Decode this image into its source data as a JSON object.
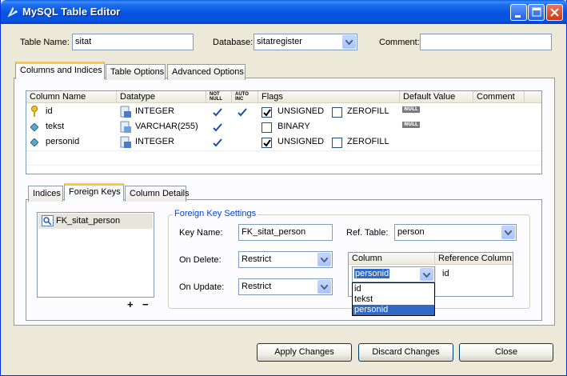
{
  "window": {
    "title": "MySQL Table Editor"
  },
  "top": {
    "table_name_label": "Table Name:",
    "table_name_value": "sitat",
    "database_label": "Database:",
    "database_value": "sitatregister",
    "comment_label": "Comment:",
    "comment_value": ""
  },
  "main_tabs": [
    {
      "label": "Columns and Indices",
      "active": true
    },
    {
      "label": "Table Options",
      "active": false
    },
    {
      "label": "Advanced Options",
      "active": false
    }
  ],
  "columns_grid": {
    "headers": {
      "column_name": "Column Name",
      "datatype": "Datatype",
      "not_null_1": "NOT",
      "not_null_2": "NULL",
      "auto_inc_1": "AUTO",
      "auto_inc_2": "INC",
      "flags": "Flags",
      "default_value": "Default Value",
      "comment": "Comment"
    },
    "rows": [
      {
        "name": "id",
        "datatype": "INTEGER",
        "not_null": true,
        "auto_inc": true,
        "flag1": "UNSIGNED",
        "flag1_checked": true,
        "flag2": "ZEROFILL",
        "flag2_checked": false,
        "default": "NULL",
        "primary_key": true
      },
      {
        "name": "tekst",
        "datatype": "VARCHAR(255)",
        "not_null": true,
        "auto_inc": false,
        "flag1": "BINARY",
        "flag1_checked": false,
        "flag2": "",
        "flag2_checked": false,
        "default": "NULL",
        "primary_key": false
      },
      {
        "name": "personid",
        "datatype": "INTEGER",
        "not_null": true,
        "auto_inc": false,
        "flag1": "UNSIGNED",
        "flag1_checked": true,
        "flag2": "ZEROFILL",
        "flag2_checked": false,
        "default": "",
        "primary_key": false
      }
    ]
  },
  "sub_tabs": [
    {
      "label": "Indices",
      "active": false
    },
    {
      "label": "Foreign Keys",
      "active": true
    },
    {
      "label": "Column Details",
      "active": false
    }
  ],
  "foreign_keys": {
    "list": [
      "FK_sitat_person"
    ],
    "add_label": "+",
    "remove_label": "−",
    "settings_title": "Foreign Key Settings",
    "key_name_label": "Key Name:",
    "key_name_value": "FK_sitat_person",
    "ref_table_label": "Ref. Table:",
    "ref_table_value": "person",
    "on_delete_label": "On Delete:",
    "on_delete_value": "Restrict",
    "on_update_label": "On Update:",
    "on_update_value": "Restrict",
    "mapping_headers": {
      "column": "Column",
      "reference_column": "Reference Column"
    },
    "mapping_row": {
      "column": "personid",
      "reference_column": "id"
    },
    "dropdown_options": [
      "id",
      "tekst",
      "personid"
    ],
    "dropdown_selected": "personid"
  },
  "buttons": {
    "apply": "Apply Changes",
    "discard": "Discard Changes",
    "close": "Close"
  },
  "colors": {
    "title_bar": "#0753df",
    "accent_tab": "#ffc83c",
    "group_title": "#0046d5",
    "selection": "#316ac5"
  }
}
